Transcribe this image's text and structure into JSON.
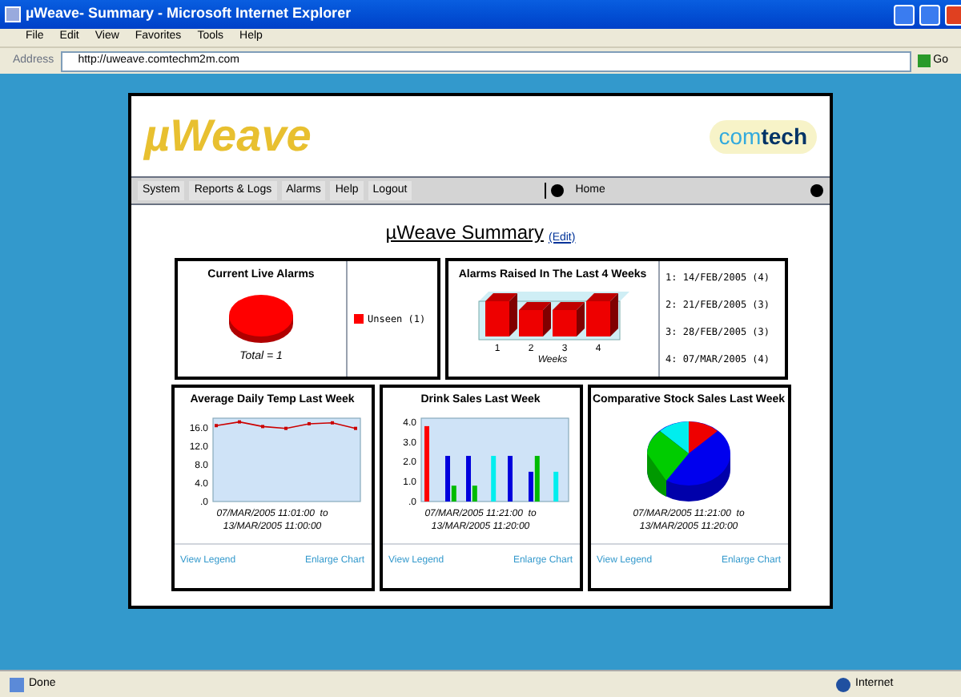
{
  "window": {
    "title": "µWeave- Summary - Microsoft Internet Explorer"
  },
  "menu": [
    "File",
    "Edit",
    "View",
    "Favorites",
    "Tools",
    "Help"
  ],
  "address": {
    "label": "Address",
    "value": "http://uweave.comtechm2m.com",
    "go": "Go"
  },
  "header": {
    "logo": "µWeave",
    "partner": [
      "com",
      "tech"
    ]
  },
  "nav": [
    "System",
    "Reports & Logs",
    "Alarms",
    "Help",
    "Logout"
  ],
  "home": "Home",
  "heading": {
    "title": "µWeave Summary",
    "edit": "(Edit)"
  },
  "live_alarms": {
    "title": "Current Live Alarms",
    "total": "Total = 1",
    "legend": [
      {
        "label": "Unseen (1)",
        "color": "#ff0000"
      }
    ]
  },
  "alarms_raised": {
    "title": "Alarms Raised In The Last 4 Weeks",
    "axis_labels": [
      "1",
      "2",
      "3",
      "4"
    ],
    "axis_title": "Weeks",
    "list": [
      "1: 14/FEB/2005 (4)",
      "2: 21/FEB/2005 (3)",
      "3: 28/FEB/2005 (3)",
      "4: 07/MAR/2005 (4)"
    ]
  },
  "panels": [
    {
      "title": "Average Daily Temp Last Week",
      "range": [
        "07/MAR/2005 11:01:00  to",
        "13/MAR/2005 11:00:00"
      ],
      "chart_data": {
        "type": "line",
        "ylim": [
          0,
          18
        ],
        "yticks": [
          {
            "value": 0,
            "label": ".0"
          },
          {
            "value": 4,
            "label": "4.0"
          },
          {
            "value": 8,
            "label": "8.0"
          },
          {
            "value": 12,
            "label": "12.0"
          },
          {
            "value": 16,
            "label": "16.0"
          }
        ],
        "series": [
          {
            "color": "#cc0000",
            "marker": "square",
            "values": [
              16.4,
              17.2,
              16.2,
              15.8,
              16.8,
              17.0,
              15.8
            ]
          }
        ]
      },
      "links": [
        "View Legend",
        "Enlarge Chart"
      ]
    },
    {
      "kind": "bars",
      "title": "Drink Sales Last Week",
      "range": [
        "07/MAR/2005 11:21:00  to",
        "13/MAR/2005 11:20:00"
      ],
      "axis_labels": [
        "4.0",
        "3.0",
        "2.0",
        "1.0",
        ".0"
      ],
      "links": [
        "View Legend",
        "Enlarge Chart"
      ]
    },
    {
      "kind": "pie",
      "title": "Comparative Stock Sales Last Week",
      "range": [
        "07/MAR/2005 11:21:00  to",
        "13/MAR/2005 11:20:00"
      ],
      "links": [
        "View Legend",
        "Enlarge Chart"
      ]
    }
  ],
  "status": {
    "text": "Done",
    "zone": "Internet"
  }
}
